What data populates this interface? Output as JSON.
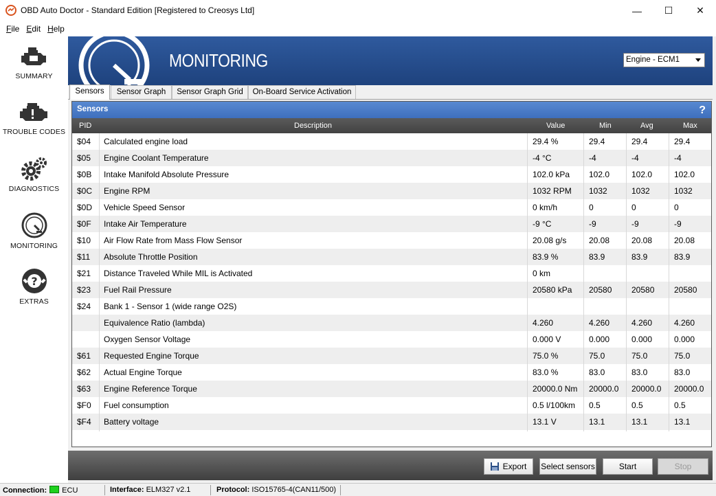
{
  "window": {
    "title": "OBD Auto Doctor - Standard Edition [Registered to Creosys Ltd]",
    "minimize": "—",
    "maximize": "☐",
    "close": "✕"
  },
  "menu": [
    "File",
    "Edit",
    "Help"
  ],
  "sidebar": {
    "items": [
      {
        "label": "SUMMARY",
        "icon": "engine-icon"
      },
      {
        "label": "TROUBLE CODES",
        "icon": "engine-warning-icon"
      },
      {
        "label": "DIAGNOSTICS",
        "icon": "gears-icon"
      },
      {
        "label": "MONITORING",
        "icon": "gauge-icon"
      },
      {
        "label": "EXTRAS",
        "icon": "lifebuoy-help-icon"
      }
    ]
  },
  "header": {
    "title": "MONITORING",
    "ecu_selected": "Engine - ECM1"
  },
  "tabs": [
    "Sensors",
    "Sensor Graph",
    "Sensor Graph Grid",
    "On-Board Service Activation"
  ],
  "panel": {
    "title": "Sensors",
    "help": "?",
    "columns": {
      "pid": "PID",
      "description": "Description",
      "value": "Value",
      "min": "Min",
      "avg": "Avg",
      "max": "Max"
    },
    "rows": [
      {
        "pid": "$04",
        "desc": "Calculated engine load",
        "value": "29.4 %",
        "min": "29.4",
        "avg": "29.4",
        "max": "29.4"
      },
      {
        "pid": "$05",
        "desc": "Engine Coolant Temperature",
        "value": "-4 °C",
        "min": "-4",
        "avg": "-4",
        "max": "-4"
      },
      {
        "pid": "$0B",
        "desc": "Intake Manifold Absolute Pressure",
        "value": "102.0 kPa",
        "min": "102.0",
        "avg": "102.0",
        "max": "102.0"
      },
      {
        "pid": "$0C",
        "desc": "Engine RPM",
        "value": "1032 RPM",
        "min": "1032",
        "avg": "1032",
        "max": "1032"
      },
      {
        "pid": "$0D",
        "desc": "Vehicle Speed Sensor",
        "value": "0 km/h",
        "min": "0",
        "avg": "0",
        "max": "0"
      },
      {
        "pid": "$0F",
        "desc": "Intake Air Temperature",
        "value": "-9 °C",
        "min": "-9",
        "avg": "-9",
        "max": "-9"
      },
      {
        "pid": "$10",
        "desc": "Air Flow Rate from Mass Flow Sensor",
        "value": "20.08 g/s",
        "min": "20.08",
        "avg": "20.08",
        "max": "20.08"
      },
      {
        "pid": "$11",
        "desc": "Absolute Throttle Position",
        "value": "83.9 %",
        "min": "83.9",
        "avg": "83.9",
        "max": "83.9"
      },
      {
        "pid": "$21",
        "desc": "Distance Traveled While MIL is Activated",
        "value": "0 km",
        "min": "",
        "avg": "",
        "max": ""
      },
      {
        "pid": "$23",
        "desc": "Fuel Rail Pressure",
        "value": "20580 kPa",
        "min": "20580",
        "avg": "20580",
        "max": "20580"
      },
      {
        "pid": "$24",
        "desc": "Bank 1 - Sensor 1 (wide range O2S)",
        "value": "",
        "min": "",
        "avg": "",
        "max": ""
      },
      {
        "pid": "",
        "desc": "Equivalence Ratio (lambda)",
        "value": "4.260",
        "min": "4.260",
        "avg": "4.260",
        "max": "4.260"
      },
      {
        "pid": "",
        "desc": "Oxygen Sensor Voltage",
        "value": "0.000 V",
        "min": "0.000",
        "avg": "0.000",
        "max": "0.000"
      },
      {
        "pid": "$61",
        "desc": "Requested Engine Torque",
        "value": "75.0 %",
        "min": "75.0",
        "avg": "75.0",
        "max": "75.0"
      },
      {
        "pid": "$62",
        "desc": "Actual Engine Torque",
        "value": "83.0 %",
        "min": "83.0",
        "avg": "83.0",
        "max": "83.0"
      },
      {
        "pid": "$63",
        "desc": "Engine Reference Torque",
        "value": "20000.0 Nm",
        "min": "20000.0",
        "avg": "20000.0",
        "max": "20000.0"
      },
      {
        "pid": "$F0",
        "desc": "Fuel consumption",
        "value": "0.5 l/100km",
        "min": "0.5",
        "avg": "0.5",
        "max": "0.5"
      },
      {
        "pid": "$F4",
        "desc": "Battery voltage",
        "value": "13.1 V",
        "min": "13.1",
        "avg": "13.1",
        "max": "13.1"
      }
    ]
  },
  "buttons": {
    "export": "Export",
    "select_sensors": "Select sensors",
    "start": "Start",
    "stop": "Stop"
  },
  "status": {
    "connection_label": "Connection:",
    "connection_value": "ECU",
    "connection_color": "#1ed11e",
    "interface_label": "Interface:",
    "interface_value": "ELM327 v2.1",
    "protocol_label": "Protocol:",
    "protocol_value": "ISO15765-4(CAN11/500)"
  },
  "colors": {
    "banner": "#2a5397",
    "panel_header": "#4a7bc8",
    "column_header": "#4e4e4e"
  }
}
